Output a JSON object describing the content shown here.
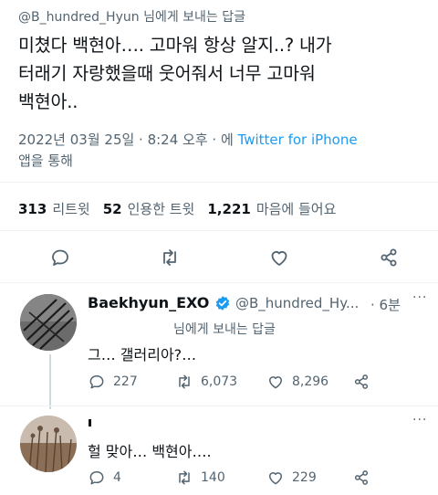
{
  "main_tweet": {
    "reply_to_handle": "@B_hundred_Hyun",
    "reply_to_suffix": " 님에게 보내는 답글",
    "text_lines": [
      "미쳤다 백현아…. 고마워 항상 알지..? 내가",
      "터래기 자랑했을때 웃어줘서 너무 고마워",
      "백현아.."
    ],
    "timestamp": "2022년 03월 25일 · 8:24 오후 · ",
    "via_prefix": "에 ",
    "app_name": "Twitter for iPhone",
    "app_suffix": "앱을 통해",
    "stats": {
      "retweets_count": "313",
      "retweets_label": "리트윗",
      "quotes_count": "52",
      "quotes_label": "인용한 트윗",
      "likes_count": "1,221",
      "likes_label": "마음에 들어요"
    },
    "actions": [
      "reply",
      "retweet",
      "like",
      "share"
    ]
  },
  "replies": [
    {
      "name": "Baekhyun_EXO",
      "verified": true,
      "handle": "@B_hundred_Hy...",
      "time": "· 6분",
      "subtext": "님에게 보내는 답글",
      "text": "그… 갤러리아?…",
      "reply_count": "227",
      "retweet_count": "6,073",
      "like_count": "8,296",
      "more_label": "···"
    },
    {
      "text": "헐 맞아… 백현아….",
      "reply_count": "4",
      "retweet_count": "140",
      "like_count": "229",
      "more_label": "···"
    }
  ],
  "colors": {
    "text": "#0f1419",
    "muted": "#536471",
    "link": "#1d9bf0",
    "divider": "#eff3f4"
  }
}
